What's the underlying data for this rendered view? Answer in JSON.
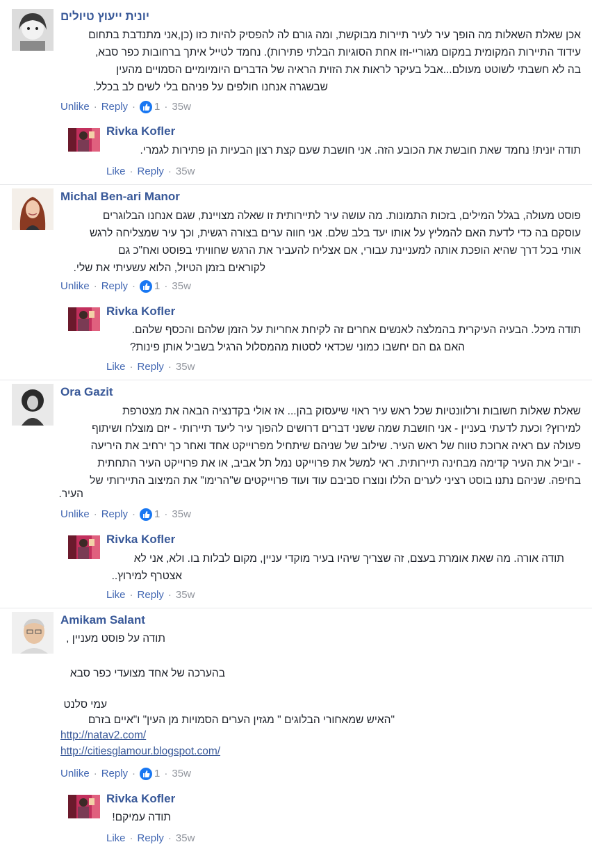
{
  "comments": [
    {
      "author": "יונית ייעוץ טיולים",
      "avatar": "avatar-girl-bw",
      "lines": [
        "אכן שאלת השאלות מה הופך עיר לעיר תיירות מבוקשת, ומה גורם לה להפסיק להיות כזו (כן,אני מתנדבת בתחום",
        "עידוד התיירות המקומית במקום מגוריי-וזו אחת הסוגיות הבלתי פתירות). נחמד לטייל איתך ברחובות כפר סבא,",
        "בה לא חשבתי לשוטט מעולם...אבל בעיקר לראות את הזוית הראיה של הדברים היומיומיים הסמויים מהעין",
        "שבשגרה אנחנו חולפים על פניהם בלי לשים לב בכלל."
      ],
      "actions": {
        "unlike": "Unlike",
        "reply": "Reply",
        "likes": "1",
        "time": "35w"
      },
      "reply": {
        "author": "Rivka Kofler",
        "lines": [
          "תודה יונית! נחמד שאת חובשת את הכובע הזה. אני חושבת שעם קצת רצון הבעיות הן פתירות לגמרי."
        ],
        "actions": {
          "like": "Like",
          "reply": "Reply",
          "time": "35w"
        }
      }
    },
    {
      "author": "Michal Ben-ari Manor",
      "avatar": "avatar-woman-red-hair",
      "lines": [
        "פוסט מעולה, בגלל המילים, בזכות התמונות. מה עושה עיר לתיירותית זו שאלה מצויינת, שגם אנחנו הבלוגרים",
        "עוסקם בה כדי לדעת האם להמליץ על אותו יעד בלב שלם. אני חווה ערים בצורה רגשית, וכך עיר שמצליחה לרגש",
        "אותי בכל דרך שהיא הופכת אותה למעניינת עבורי, אם אצליח להעביר את הרגש שחוויתי בפוסט ואח\"כ גם",
        "לקוראים בזמן הטיול, הלוא עשעיתי את שלי."
      ],
      "actions": {
        "unlike": "Unlike",
        "reply": "Reply",
        "likes": "1",
        "time": "35w"
      },
      "reply": {
        "author": "Rivka Kofler",
        "lines": [
          "תודה מיכל. הבעיה העיקרית בהמלצה לאנשים אחרים זה לקיחת אחריות על הזמן שלהם והכסף שלהם.",
          "האם גם הם יחשבו כמוני שכדאי לסטות מהמסלול הרגיל בשביל אותן פינות?"
        ],
        "actions": {
          "like": "Like",
          "reply": "Reply",
          "time": "35w"
        }
      }
    },
    {
      "author": "Ora Gazit",
      "avatar": "avatar-curly-hair-bw",
      "lines": [
        "שאלת שאלות חשובות ורלוונטיות שכל ראש עיר ראוי שיעסוק בהן... אז אולי בקדנציה הבאה את מצטרפת",
        "למירוץ? וכעת לדעתי בעניין - אני חושבת שמה ששני דברים דרושים להפוך עיר ליעד תיירותי - יזם מוצלח ושיתוף",
        "פעולה עם ראיה ארוכת טווח של ראש העיר. שילוב של שניהם שיתחיל מפרוייקט אחד ואחר כך ירחיב את היריעה",
        "- יוביל את העיר קדימה מבחינה תיירותית. ראי למשל את פרוייקט נמל תל אביב, או את פרוייקט העיר התחתית",
        "בחיפה. שניהם נתנו בוסט רציני לערים הללו ונוצרו סביבם עוד ועוד פרוייקטים ש\"הרימו\" את המיצוב התיירותי של",
        "העיר."
      ],
      "actions": {
        "unlike": "Unlike",
        "reply": "Reply",
        "likes": "1",
        "time": "35w"
      },
      "reply": {
        "author": "Rivka Kofler",
        "lines": [
          "תודה אורה. מה שאת אומרת בעצם, זה שצריך שיהיו בעיר מוקדי עניין, מקום לבלות בו. ולא, אני לא",
          "אצטרף למירוץ.."
        ],
        "actions": {
          "like": "Like",
          "reply": "Reply",
          "time": "35w"
        }
      }
    },
    {
      "author": "Amikam Salant",
      "avatar": "avatar-man-gray",
      "lines": [
        "תודה על פוסט מעניין ,",
        "",
        "בהערכה של אחד מצועדי כפר סבא",
        "",
        "עמי סלנט",
        "\"האיש שמאחורי הבלוגים \" מגזין הערים הסמויות מן העין\" ו\"איים בזרם"
      ],
      "links": [
        "http://natav2.com/",
        "http://citiesglamour.blogspot.com/"
      ],
      "actions": {
        "unlike": "Unlike",
        "reply": "Reply",
        "likes": "1",
        "time": "35w"
      },
      "reply": {
        "author": "Rivka Kofler",
        "lines": [
          "תודה עמיקם!"
        ],
        "actions": {
          "like": "Like",
          "reply": "Reply",
          "time": "35w"
        }
      }
    }
  ],
  "colors": {
    "link": "#385898",
    "action": "#4267b2",
    "meta": "#90949c",
    "like_blue": "#1877f2"
  }
}
